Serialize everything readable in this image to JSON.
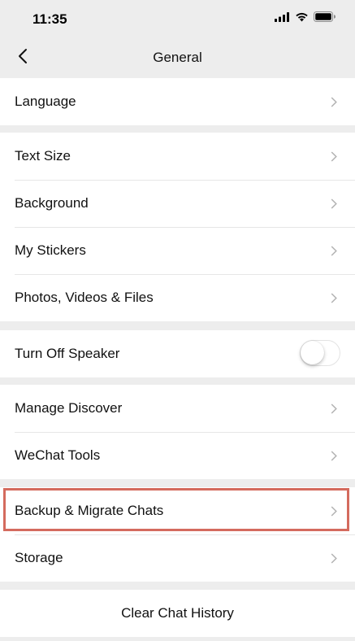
{
  "status_bar": {
    "time": "11:35",
    "icons": [
      "signal-icon",
      "wifi-icon",
      "battery-icon"
    ]
  },
  "nav": {
    "back_icon": "chevron-left-icon",
    "title": "General"
  },
  "groups": [
    {
      "items": [
        {
          "label": "Language"
        }
      ]
    },
    {
      "items": [
        {
          "label": "Text Size"
        },
        {
          "label": "Background"
        },
        {
          "label": "My Stickers"
        },
        {
          "label": "Photos, Videos & Files"
        }
      ]
    },
    {
      "items": [
        {
          "label": "Turn Off Speaker",
          "toggle": false
        }
      ]
    },
    {
      "items": [
        {
          "label": "Manage Discover"
        },
        {
          "label": "WeChat Tools"
        }
      ]
    },
    {
      "items": [
        {
          "label": "Backup & Migrate Chats",
          "highlighted": true
        },
        {
          "label": "Storage"
        }
      ]
    }
  ],
  "clear_history": {
    "label": "Clear Chat History"
  },
  "colors": {
    "background": "#ededed",
    "highlight": "#d46b5e"
  }
}
